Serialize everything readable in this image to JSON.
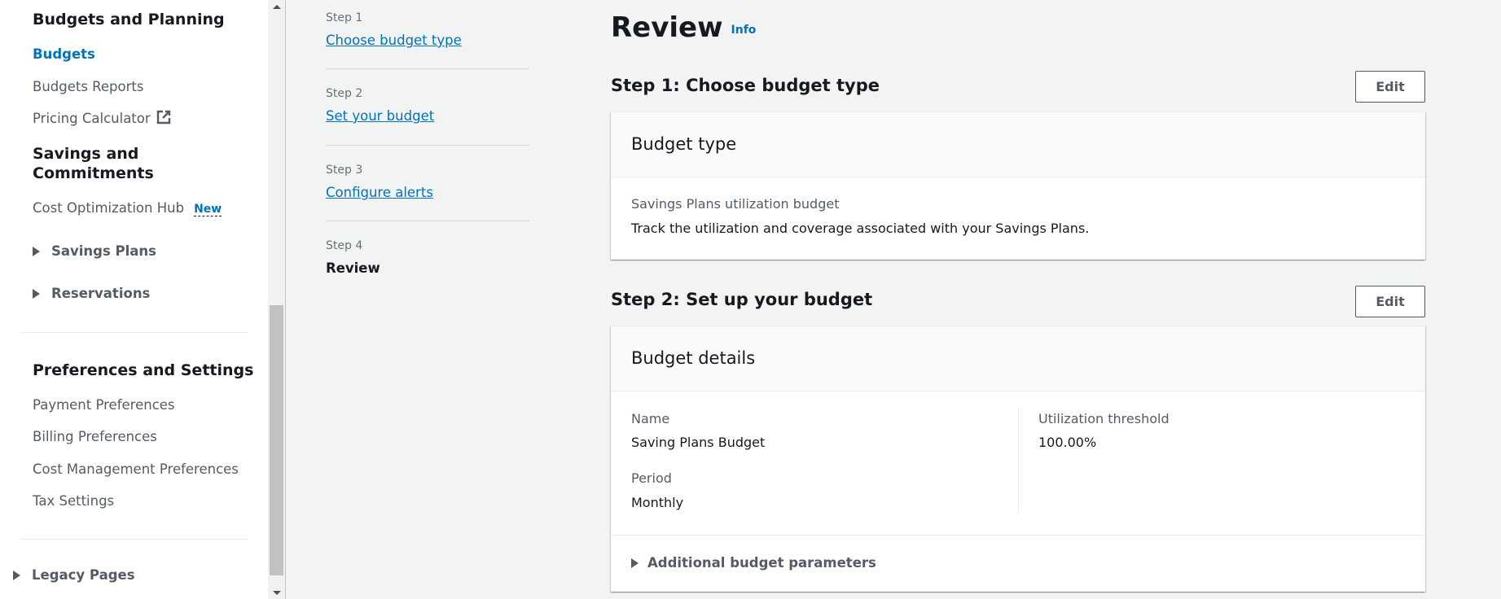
{
  "sidebar": {
    "sections": [
      {
        "heading": "Budgets and Planning",
        "items": [
          {
            "label": "Budgets",
            "active": true
          },
          {
            "label": "Budgets Reports"
          },
          {
            "label": "Pricing Calculator",
            "icon": "external-link-icon"
          }
        ]
      },
      {
        "heading_line1": "Savings and",
        "heading_line2": "Commitments",
        "items": [
          {
            "label": "Cost Optimization Hub",
            "badge": "New"
          },
          {
            "label": "Savings Plans",
            "expandable": true
          },
          {
            "label": "Reservations",
            "expandable": true
          }
        ]
      },
      {
        "heading": "Preferences and Settings",
        "items": [
          {
            "label": "Payment Preferences"
          },
          {
            "label": "Billing Preferences"
          },
          {
            "label": "Cost Management Preferences"
          },
          {
            "label": "Tax Settings"
          }
        ]
      }
    ],
    "legacy": {
      "label": "Legacy Pages",
      "expandable": true
    }
  },
  "wizard": {
    "steps": [
      {
        "number": "Step 1",
        "label": "Choose budget type",
        "link": true
      },
      {
        "number": "Step 2",
        "label": "Set your budget",
        "link": true
      },
      {
        "number": "Step 3",
        "label": "Configure alerts",
        "link": true
      },
      {
        "number": "Step 4",
        "label": "Review",
        "current": true
      }
    ]
  },
  "main": {
    "title": "Review",
    "info_label": "Info",
    "sections": [
      {
        "heading": "Step 1: Choose budget type",
        "edit_label": "Edit",
        "card": {
          "title": "Budget type",
          "type_name": "Savings Plans utilization budget",
          "type_description": "Track the utilization and coverage associated with your Savings Plans."
        }
      },
      {
        "heading": "Step 2: Set up your budget",
        "edit_label": "Edit",
        "card": {
          "title": "Budget details",
          "fields": {
            "name": {
              "key": "Name",
              "value": "Saving Plans Budget"
            },
            "period": {
              "key": "Period",
              "value": "Monthly"
            },
            "threshold": {
              "key": "Utilization threshold",
              "value": "100.00%"
            }
          },
          "expander_label": "Additional budget parameters"
        }
      }
    ]
  },
  "colors": {
    "link": "#0073bb",
    "text": "#16191f",
    "muted": "#545b64",
    "page_bg": "#f2f3f3"
  }
}
